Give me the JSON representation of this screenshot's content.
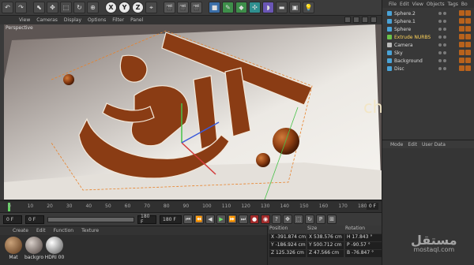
{
  "toolbar": {
    "axis_x": "X",
    "axis_y": "Y",
    "axis_z": "Z"
  },
  "viewport_menu": {
    "items": [
      "View",
      "Cameras",
      "Display",
      "Options",
      "Filter",
      "Panel"
    ],
    "label": "Perspective"
  },
  "timeline": {
    "ticks": [
      "0",
      "10",
      "20",
      "30",
      "40",
      "50",
      "60",
      "70",
      "80",
      "90",
      "100",
      "110",
      "120",
      "130",
      "140",
      "150",
      "160",
      "170",
      "180"
    ],
    "current_frame": "0 F",
    "progress": 0.0
  },
  "transport": {
    "start": "0 F",
    "min": "0 F",
    "max_slider": "180 F",
    "end": "180 F"
  },
  "materials": {
    "menu": [
      "Create",
      "Edit",
      "Function",
      "Texture"
    ],
    "items": [
      {
        "name": "Mat",
        "color": "#8a5a3a"
      },
      {
        "name": "backgro",
        "color": "#7a6e6a"
      },
      {
        "name": "HDRI 00",
        "color": "#9a9a9a"
      }
    ]
  },
  "coordinates": {
    "headers": [
      "Position",
      "Size",
      "Rotation"
    ],
    "rows": [
      [
        "X -391.874 cm",
        "X 538.576 cm",
        "H 17.843 °"
      ],
      [
        "Y -186.924 cm",
        "Y 500.712 cm",
        "P -90.57 °"
      ],
      [
        "Z 125.326 cm",
        "Z 47.566 cm",
        "B -76.847 °"
      ]
    ]
  },
  "objects": {
    "menu": [
      "File",
      "Edit",
      "View",
      "Objects",
      "Tags",
      "Bo"
    ],
    "items": [
      {
        "name": "Sphere.2",
        "icon": "sphere-icon",
        "color": "#4aa3d8",
        "active": false
      },
      {
        "name": "Sphere.1",
        "icon": "sphere-icon",
        "color": "#4aa3d8",
        "active": false
      },
      {
        "name": "Sphere",
        "icon": "sphere-icon",
        "color": "#4aa3d8",
        "active": false
      },
      {
        "name": "Extrude NURBS",
        "icon": "extrude-icon",
        "color": "#6ac24a",
        "active": true
      },
      {
        "name": "Camera",
        "icon": "camera-icon",
        "color": "#bbbbbb",
        "active": false
      },
      {
        "name": "Sky",
        "icon": "sky-icon",
        "color": "#4aa3d8",
        "active": false
      },
      {
        "name": "Background",
        "icon": "background-icon",
        "color": "#4aa3d8",
        "active": false
      },
      {
        "name": "Disc",
        "icon": "disc-icon",
        "color": "#4aa3d8",
        "active": false
      }
    ]
  },
  "attributes": {
    "menu": [
      "Mode",
      "Edit",
      "User Data"
    ]
  },
  "overlay": {
    "text": "chicou"
  },
  "watermark": {
    "arabic": "مستقل",
    "latin": "mostaql.com"
  },
  "colors": {
    "accent": "#5fd35f",
    "object_orange": "#b8621c",
    "active_object": "#ffd35a"
  }
}
